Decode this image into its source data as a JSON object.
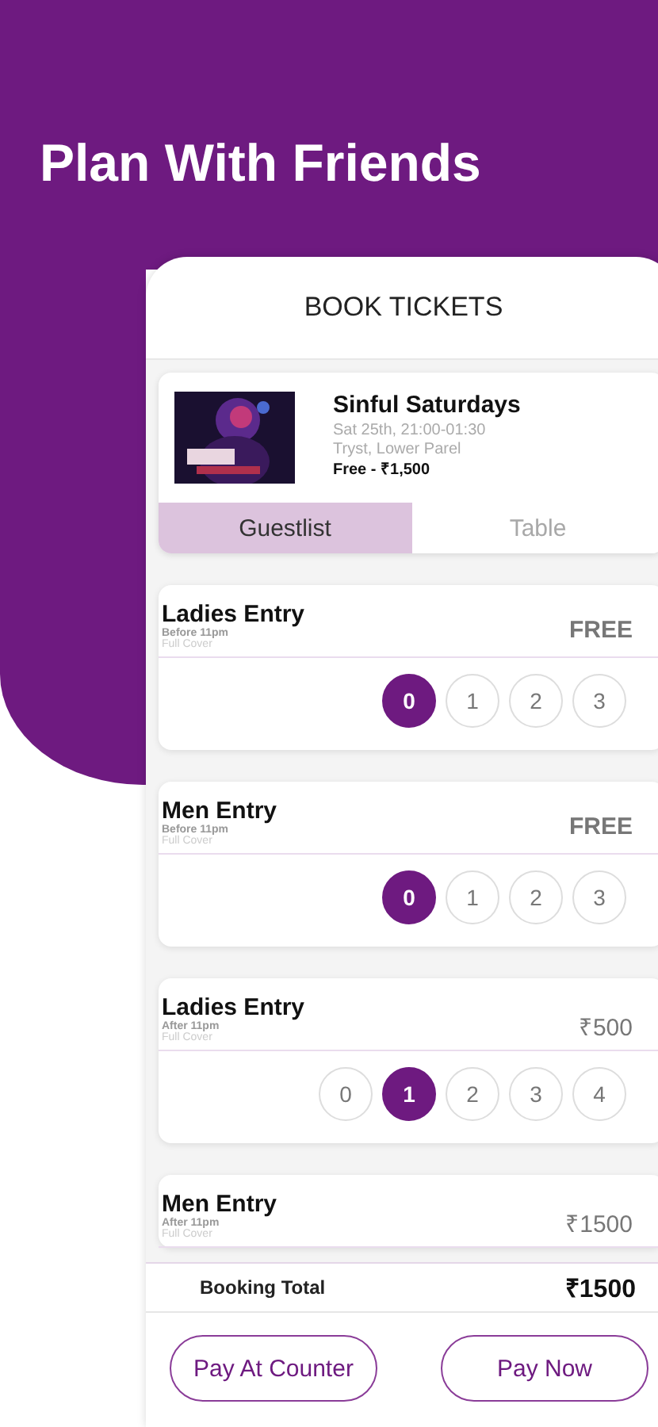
{
  "headline": "Plan With Friends",
  "screen_title": "BOOK TICKETS",
  "event": {
    "name": "Sinful Saturdays",
    "date": "Sat 25th, 21:00-01:30",
    "venue": "Tryst, Lower Parel",
    "price": "Free - ₹1,500"
  },
  "tabs": [
    {
      "label": "Guestlist",
      "selected": true
    },
    {
      "label": "Table",
      "selected": false
    }
  ],
  "tickets": [
    {
      "name": "Ladies Entry",
      "time": "Before 11pm",
      "cover": "Full Cover",
      "price": "FREE",
      "counts": [
        {
          "label": "0",
          "selected": true
        },
        {
          "label": "1",
          "selected": false
        },
        {
          "label": "2",
          "selected": false
        },
        {
          "label": "3",
          "selected": false
        }
      ]
    },
    {
      "name": "Men Entry",
      "time": "Before 11pm",
      "cover": "Full Cover",
      "price": "FREE",
      "counts": [
        {
          "label": "0",
          "selected": true
        },
        {
          "label": "1",
          "selected": false
        },
        {
          "label": "2",
          "selected": false
        },
        {
          "label": "3",
          "selected": false
        }
      ]
    },
    {
      "name": "Ladies Entry",
      "time": "After 11pm",
      "cover": "Full Cover",
      "price": "₹500",
      "counts": [
        {
          "label": "0",
          "selected": false
        },
        {
          "label": "1",
          "selected": true
        },
        {
          "label": "2",
          "selected": false
        },
        {
          "label": "3",
          "selected": false
        },
        {
          "label": "4",
          "selected": false
        }
      ]
    },
    {
      "name": "Men Entry",
      "time": "After  11pm",
      "cover": "Full Cover",
      "price": "₹1500"
    }
  ],
  "total": {
    "label": "Booking Total",
    "amount": "₹1500"
  },
  "buttons": [
    "Pay At Counter",
    "Pay Now"
  ]
}
